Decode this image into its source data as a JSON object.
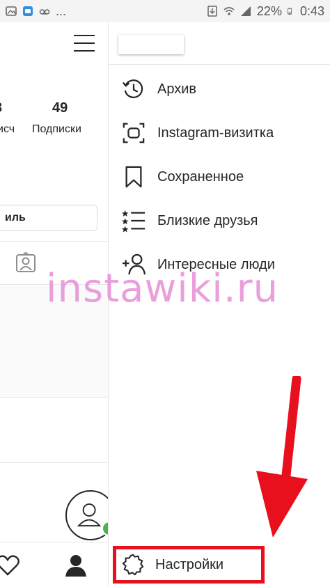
{
  "status_bar": {
    "icons_left": [
      "photo-icon",
      "messages-icon",
      "voicemail-icon"
    ],
    "dots": "...",
    "battery_percent": "22%",
    "time": "0:43"
  },
  "profile": {
    "stat_followers_num": "3",
    "stat_followers_label": "исч",
    "stat_following_num": "49",
    "stat_following_label": "Подписки",
    "edit_button_label": "иль"
  },
  "drawer": {
    "username": "",
    "items": [
      {
        "label": "Архив",
        "icon": "archive-icon"
      },
      {
        "label": "Instagram-визитка",
        "icon": "nametag-icon"
      },
      {
        "label": "Сохраненное",
        "icon": "bookmark-icon"
      },
      {
        "label": "Близкие друзья",
        "icon": "close-friends-icon"
      },
      {
        "label": "Интересные люди",
        "icon": "discover-people-icon"
      }
    ],
    "settings_label": "Настройки"
  },
  "watermark": "instawiki.ru",
  "colors": {
    "highlight_red": "#e8101c",
    "watermark_pink": "#e78fd7",
    "online_green": "#4caf50"
  }
}
